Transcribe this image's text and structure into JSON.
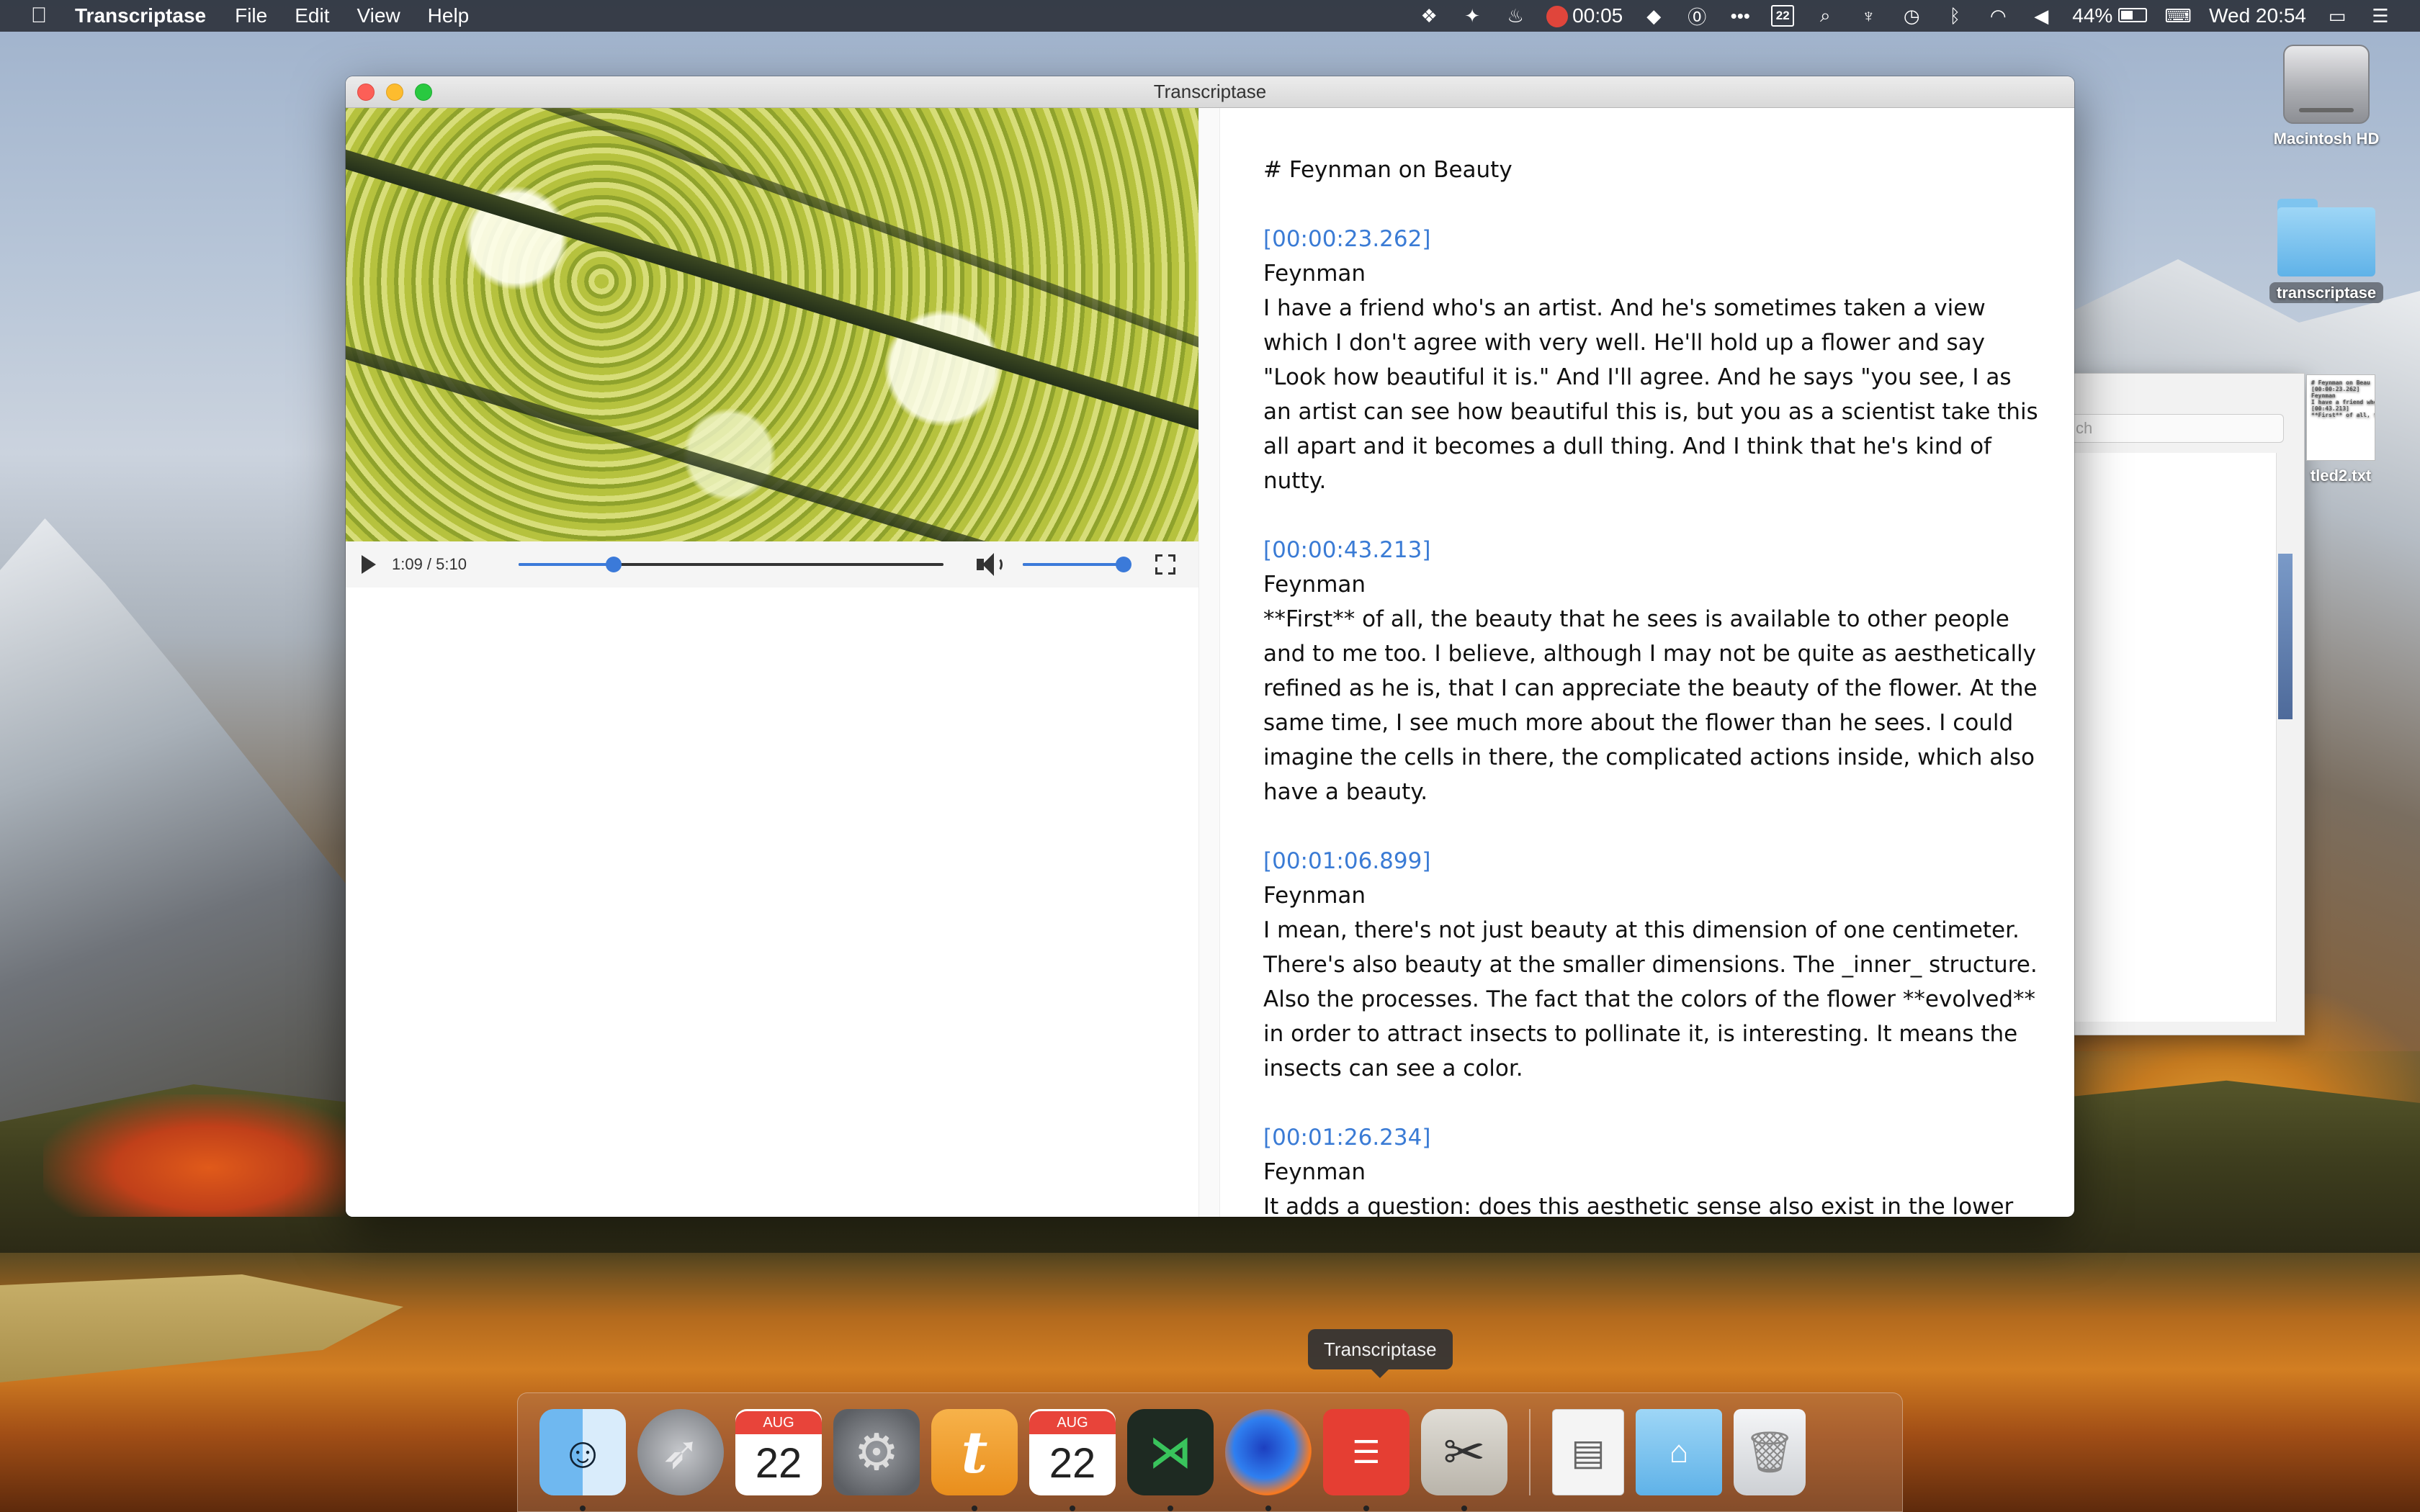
{
  "menubar": {
    "apple_glyph": "",
    "app_name": "Transcriptase",
    "menus": [
      "File",
      "Edit",
      "View",
      "Help"
    ],
    "status": {
      "recording_time": "00:05",
      "calendar_day": "22",
      "battery_percent": "44%",
      "datetime": "Wed 20:54"
    },
    "icons": [
      "dropbox-icon",
      "fire-icon",
      "recording-icon",
      "shield-icon",
      "onepassword-icon",
      "more-icon",
      "calendar-icon",
      "search-icon",
      "antenna-icon",
      "time-machine-icon",
      "bluetooth-icon",
      "wifi-icon",
      "volume-icon",
      "battery-icon",
      "keyboard-icon",
      "airplay-icon",
      "menu-icon"
    ]
  },
  "desktop": {
    "hd_label": "Macintosh HD",
    "folder_label": "transcriptase",
    "file_label": "tled2.txt",
    "file_preview": "# Feynman on Beau\n[00:00:23.262]\nFeynman\nI have a friend who's\n[00:43.213]\n**First** of all, the",
    "behind_search_placeholder": "ch"
  },
  "window": {
    "title": "Transcriptase",
    "player": {
      "current_time": "1:09",
      "duration": "5:10",
      "time_display": "1:09 / 5:10",
      "progress": 0.223,
      "volume": 1.0
    },
    "document": {
      "heading": "# Feynman on Beauty",
      "segments": [
        {
          "timestamp": "[00:00:23.262]",
          "speaker": "Feynman",
          "text": "I have a friend who's an artist. And he's sometimes taken a view which I don't agree with very well. He'll hold up a flower and say \"Look how beautiful it is.\" And I'll agree. And he says \"you see, I as an artist can see how beautiful this is, but you as a scientist take this all apart and it becomes a dull thing. And I think that he's kind of nutty."
        },
        {
          "timestamp": "[00:00:43.213]",
          "speaker": "Feynman",
          "text": "**First** of all, the beauty that he sees is available to other people and to me too. I believe, although I may not be quite as aesthetically refined as he is, that I can appreciate the beauty of the flower. At the same time, I see much more about the flower than he sees. I could imagine the cells in there, the complicated actions inside, which also have a beauty."
        },
        {
          "timestamp": "[00:01:06.899]",
          "speaker": "Feynman",
          "text": "I mean, there's not just beauty at this dimension of one centimeter. There's also beauty at the smaller dimensions. The _inner_ structure. Also the processes. The fact that the colors of the flower **evolved** in order to attract insects to pollinate it, is interesting. It means the insects can see a color."
        },
        {
          "timestamp": "[00:01:26.234]",
          "speaker": "Feynman",
          "text": "It adds a question: does this aesthetic sense also exist in the lower forms? Does it--**why** is it aesthetic? All kinds of _interesting"
        }
      ]
    }
  },
  "dock": {
    "tooltip": "Transcriptase",
    "calendar_month": "AUG",
    "calendar_day": "22",
    "calendar_month_2": "AUG",
    "calendar_day_2": "22"
  },
  "colors": {
    "accent": "#3b7ad9",
    "timestamp_link": "#3a7bd5",
    "menubar_bg": "#282c36"
  }
}
